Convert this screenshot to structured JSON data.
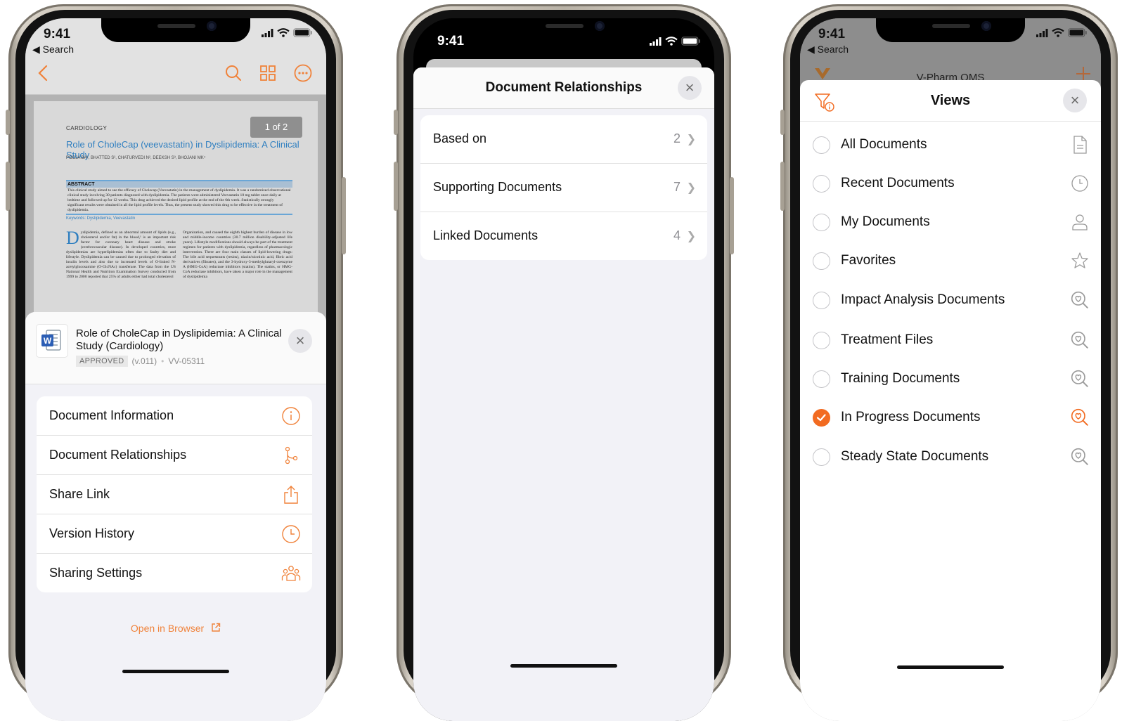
{
  "colors": {
    "accent": "#f26b21",
    "secondary_text": "#8e8e93",
    "doc_link_blue": "#2f7fc0"
  },
  "status": {
    "time": "9:41",
    "back_label": "◀ Search"
  },
  "phone1": {
    "nav_icons": [
      "back-chevron-icon",
      "search-icon",
      "grid-icon",
      "more-icon"
    ],
    "document": {
      "page_indicator": "1 of 2",
      "kicker": "CARDIOLOGY",
      "title": "Role of CholeCap (veevastatin) in Dyslipidemia: A Clinical Study",
      "authors": "POOJA BA¹, BHATTED S², CHATURVEDI N², DEEKSH S³, BHOJANI MK⁴",
      "abstract_heading": "ABSTRACT",
      "abstract_text": "This clinical study aimed to see the efficacy of Cholecap (Veevastatin) in the management of dyslipidemia. It was a randomized observational clinical study involving 30 patients diagnosed with dyslipidemia. The patients were administered Veevastatin 10 mg tablet once-daily at bedtime and followed up for 12 weeks. This drug achieved the desired lipid profile at the end of the 6th week. Statistically strongly significant results were obtained in all the lipid profile levels. Thus, the present study showed this drug to be effective in the treatment of dyslipidemia.",
      "keywords": "Keywords: Dyslipidemia, Veevastatin",
      "dropcap": "D",
      "col1": "yslipidemia, defined as an abnormal amount of lipids (e.g., cholesterol and/or fat) in the blood,¹ is an important risk factor for coronary heart disease and stroke (cerebrovascular disease). In developed countries, most dyslipidemias are hyperlipidemias often due to faulty diet and lifestyle. Dyslipidemia can be caused due to prolonged elevation of insulin levels and also due to increased levels of O-linked N-acetylglucosamine (O-GlcNAc) transferase. The data from the US National Health and Nutrition Examination Survey conducted from 1999 to 2000 reported that 25% of adults either had total cholesterol",
      "col2": "Organization, and caused the eighth highest burden of disease in low and middle-income countries (30.7 million disability-adjusted life years). Lifestyle modifications should always be part of the treatment regimen for patients with dyslipidemia, regardless of pharmacologic intervention. There are four main classes of lipid-lowering drugs: The bile acid sequestrants (resins), niacin/nicotinic acid, fibric acid derivatives (fibrates), and the 3-hydroxy-3-methylglutaryl-coenzyme A (HMG-CoA) reductase inhibitors (statins). The statins, or HMG-CoA reductase inhibitors, have taken a major role in the management of dyslipidemia"
    },
    "sheet": {
      "title": "Role of CholeCap in Dyslipidemia: A Clinical Study (Cardiology)",
      "status_badge": "APPROVED",
      "version": "(v.011)",
      "separator": "•",
      "doc_number": "VV-05311",
      "items": [
        {
          "label": "Document Information",
          "icon": "info-icon"
        },
        {
          "label": "Document Relationships",
          "icon": "relationships-icon"
        },
        {
          "label": "Share Link",
          "icon": "share-icon"
        },
        {
          "label": "Version History",
          "icon": "clock-icon"
        },
        {
          "label": "Sharing Settings",
          "icon": "people-icon"
        }
      ],
      "open_browser": "Open in Browser"
    }
  },
  "phone2": {
    "title": "Document Relationships",
    "items": [
      {
        "label": "Based on",
        "count": "2"
      },
      {
        "label": "Supporting Documents",
        "count": "7"
      },
      {
        "label": "Linked Documents",
        "count": "4"
      }
    ]
  },
  "phone3": {
    "app_title": "V-Pharm QMS",
    "title": "Views",
    "items": [
      {
        "label": "All Documents",
        "icon": "document-icon",
        "selected": false
      },
      {
        "label": "Recent Documents",
        "icon": "clock-icon",
        "selected": false
      },
      {
        "label": "My Documents",
        "icon": "person-icon",
        "selected": false
      },
      {
        "label": "Favorites",
        "icon": "star-icon",
        "selected": false
      },
      {
        "label": "Impact Analysis Documents",
        "icon": "saved-search-icon",
        "selected": false
      },
      {
        "label": "Treatment Files",
        "icon": "saved-search-icon",
        "selected": false
      },
      {
        "label": "Training Documents",
        "icon": "saved-search-icon",
        "selected": false
      },
      {
        "label": "In Progress Documents",
        "icon": "saved-search-icon",
        "selected": true
      },
      {
        "label": "Steady State Documents",
        "icon": "saved-search-icon",
        "selected": false
      }
    ]
  }
}
